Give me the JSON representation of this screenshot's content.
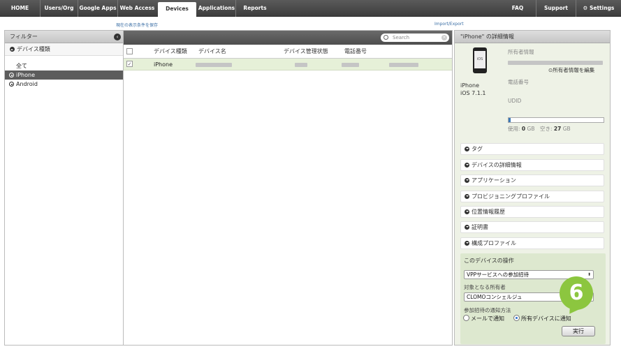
{
  "nav": {
    "items": [
      "HOME",
      "Users/Org",
      "Google Apps",
      "Web Access",
      "Devices",
      "Applications",
      "Reports"
    ],
    "active": "Devices",
    "right_items": [
      "FAQ",
      "Support",
      "Settings"
    ]
  },
  "sublinks": {
    "save_view": "現在の表示条件を保存",
    "import_export": "Import/Export"
  },
  "filter": {
    "title": "フィルター",
    "section": "デバイス種類",
    "items": [
      "全て",
      "iPhone",
      "Android"
    ],
    "selected": "iPhone"
  },
  "table": {
    "search_placeholder": "Search",
    "headers": [
      "デバイス種類",
      "デバイス名",
      "デバイス管理状態",
      "電話番号"
    ],
    "rows": [
      {
        "type": "iPhone",
        "checked": true
      }
    ]
  },
  "detail": {
    "title": "\"iPhone\" の詳細情報",
    "device_model": "iPhone",
    "device_os": "iOS 7.1.1",
    "owner_label": "所有者情報",
    "edit_owner": "所有者情報を編集",
    "phone_label": "電話番号",
    "udid_label": "UDID",
    "storage": {
      "used_label": "使用:",
      "used_value": "0",
      "free_label": "空き:",
      "free_value": "27",
      "unit": "GB",
      "used_fraction": 0.02
    },
    "accordions": [
      "タグ",
      "デバイスの詳細情報",
      "アプリケーション",
      "プロビジョニングプロファイル",
      "位置情報履歴",
      "証明書",
      "構成プロファイル"
    ],
    "operations": {
      "title": "このデバイスの操作",
      "action_select": "VPPサービスへの参加招待",
      "owner_label": "対象となる所有者",
      "owner_select": "CLOMOコンシェルジュ",
      "notify_label": "参加招待の通知方法",
      "radio_mail": "メールで通知",
      "radio_device": "所有デバイスに通知",
      "execute": "実行"
    }
  },
  "marker": {
    "number": "6",
    "color": "#8cc63f"
  },
  "colors": {
    "accent": "#3b7ab8",
    "selected_row": "#e6f0d8",
    "panel_bg": "#eef2e6"
  }
}
